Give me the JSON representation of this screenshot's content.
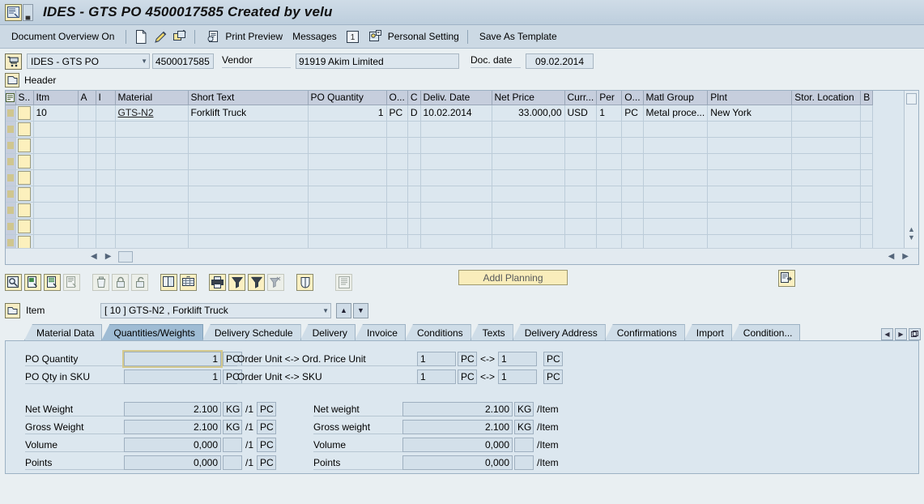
{
  "window": {
    "title": "IDES - GTS PO 4500017585 Created by velu",
    "icon": "sap-logo-icon"
  },
  "function_bar": {
    "document_overview": "Document Overview On",
    "icons": [
      "new-document-icon",
      "edit-pencil-icon",
      "hold-copy-icon"
    ],
    "print_preview": "Print Preview",
    "messages": "Messages",
    "help_number": "1",
    "personal_setting": "Personal Setting",
    "save_as_template": "Save As Template"
  },
  "header": {
    "doc_type": "IDES - GTS PO",
    "doc_number": "4500017585",
    "vendor_label": "Vendor",
    "vendor_value": "91919 Akim Limited",
    "doc_date_label": "Doc. date",
    "doc_date_value": "09.02.2014",
    "header_tab": "Header"
  },
  "items_table": {
    "columns": [
      "S..",
      "Itm",
      "A",
      "I",
      "Material",
      "Short Text",
      "PO Quantity",
      "O...",
      "C",
      "Deliv. Date",
      "Net Price",
      "Curr...",
      "Per",
      "O...",
      "Matl Group",
      "Plnt",
      "Stor. Location",
      "B"
    ],
    "rows": [
      {
        "itm": "10",
        "a": "",
        "i": "",
        "material": "GTS-N2",
        "short_text": "Forklift Truck",
        "po_quantity": "1",
        "ou": "PC",
        "c": "D",
        "deliv_date": "10.02.2014",
        "net_price": "33.000,00",
        "curr": "USD",
        "per": "1",
        "o2": "PC",
        "matl_group": "Metal proce...",
        "plnt": "New York",
        "stor_location": "",
        "b": ""
      }
    ],
    "empty_row_count": 8
  },
  "item_toolbar": {
    "icons": [
      "detail-magnifier-icon",
      "insert-row-icon",
      "copy-row-icon",
      "paste-row-icon",
      "delete-trash-icon",
      "lock-closed-icon",
      "lock-open-icon",
      "duplicate-icon",
      "layout-grid-icon",
      "print-icon",
      "filter-funnel-icon",
      "sort-filter-icon",
      "filter-clear-icon",
      "shield-icon",
      "list-detail-icon"
    ],
    "addl_planning": "Addl Planning",
    "right_icon": "copy-export-icon"
  },
  "item_selector": {
    "label": "Item",
    "value": "[ 10 ] GTS-N2 , Forklift Truck",
    "up_icon": "arrow-up-icon",
    "down_icon": "arrow-down-icon"
  },
  "tabs": {
    "active": "Quantities/Weights",
    "items": [
      "Material Data",
      "Quantities/Weights",
      "Delivery Schedule",
      "Delivery",
      "Invoice",
      "Conditions",
      "Texts",
      "Delivery Address",
      "Confirmations",
      "Import",
      "Condition..."
    ],
    "nav": [
      "prev-tab-icon",
      "next-tab-icon",
      "tab-list-icon"
    ]
  },
  "detail": {
    "po_quantity": {
      "label": "PO Quantity",
      "value": "1",
      "unit": "PC"
    },
    "po_qty_sku": {
      "label": "PO Qty in SKU",
      "value": "1",
      "unit": "PC"
    },
    "order_unit_price": {
      "label": "Order Unit <-> Ord. Price Unit",
      "left_value": "1",
      "left_unit": "PC",
      "separator": "<->",
      "right_value": "1",
      "right_unit": "PC"
    },
    "order_unit_sku": {
      "label": "Order Unit <-> SKU",
      "left_value": "1",
      "left_unit": "PC",
      "separator": "<->",
      "right_value": "1",
      "right_unit": "PC"
    },
    "left_rows": [
      {
        "label": "Net Weight",
        "value": "2.100",
        "unit": "KG",
        "per": "/1",
        "per_unit": "PC"
      },
      {
        "label": "Gross Weight",
        "value": "2.100",
        "unit": "KG",
        "per": "/1",
        "per_unit": "PC"
      },
      {
        "label": "Volume",
        "value": "0,000",
        "unit": "",
        "per": "/1",
        "per_unit": "PC"
      },
      {
        "label": "Points",
        "value": "0,000",
        "unit": "",
        "per": "/1",
        "per_unit": "PC"
      }
    ],
    "right_rows": [
      {
        "label": "Net weight",
        "value": "2.100",
        "unit": "KG",
        "suffix": "/Item"
      },
      {
        "label": "Gross weight",
        "value": "2.100",
        "unit": "KG",
        "suffix": "/Item"
      },
      {
        "label": "Volume",
        "value": "0,000",
        "unit": "",
        "suffix": "/Item"
      },
      {
        "label": "Points",
        "value": "0,000",
        "unit": "",
        "suffix": "/Item"
      }
    ]
  },
  "colors": {
    "title_bar": "#c4d3e0",
    "toolbar": "#ccd9e4",
    "panel_bg": "#dce7ef",
    "table_header": "#c6cedd",
    "active_tab": "#9fbcd4",
    "button_yellow": "#fbf0c2"
  }
}
